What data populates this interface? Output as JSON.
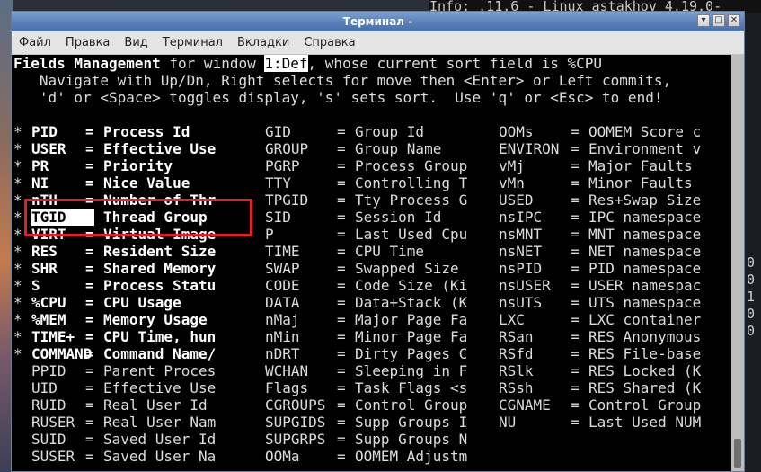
{
  "desktop": {
    "top_right_text": "Info: .11.6 - Linux astakhov 4.19.0-",
    "right_column": [
      "0",
      "0",
      "1",
      "0",
      "0"
    ]
  },
  "window": {
    "title": "Терминал -",
    "buttons": [
      "▾",
      "□",
      "✕"
    ],
    "menu": [
      "Файл",
      "Правка",
      "Вид",
      "Терминал",
      "Вкладки",
      "Справка"
    ]
  },
  "terminal": {
    "header": {
      "line1_bold": "Fields Management",
      "line1_mid": " for window ",
      "line1_win": "1:Def",
      "line1_end": ", whose current sort field is %CPU",
      "line2": "   Navigate with Up/Dn, Right selects for move then <Enter> or Left commits,",
      "line3": "   'd' or <Space> toggles display, 's' sets sort.  Use 'q' or <Esc> to end!"
    },
    "columns": [
      [
        {
          "mark": "*",
          "name": "PID",
          "desc": "Process Id",
          "on": true
        },
        {
          "mark": "*",
          "name": "USER",
          "desc": "Effective Use",
          "on": true
        },
        {
          "mark": "*",
          "name": "PR",
          "desc": "Priority",
          "on": true
        },
        {
          "mark": "*",
          "name": "NI",
          "desc": "Nice Value",
          "on": true
        },
        {
          "mark": "*",
          "name": "nTH",
          "desc": "Number of Thr",
          "on": true
        },
        {
          "mark": "*",
          "name": "TGID",
          "desc": "Thread Group",
          "on": true,
          "selected": true
        },
        {
          "mark": "*",
          "name": "VIRT",
          "desc": "Virtual Image",
          "on": true
        },
        {
          "mark": "*",
          "name": "RES",
          "desc": "Resident Size",
          "on": true
        },
        {
          "mark": "*",
          "name": "SHR",
          "desc": "Shared Memory",
          "on": true
        },
        {
          "mark": "*",
          "name": "S",
          "desc": "Process Statu",
          "on": true
        },
        {
          "mark": "*",
          "name": "%CPU",
          "desc": "CPU Usage",
          "on": true
        },
        {
          "mark": "*",
          "name": "%MEM",
          "desc": "Memory Usage",
          "on": true
        },
        {
          "mark": "*",
          "name": "TIME+",
          "desc": "CPU Time, hun",
          "on": true
        },
        {
          "mark": "*",
          "name": "COMMAND",
          "desc": "Command Name/",
          "on": true
        },
        {
          "mark": "",
          "name": "PPID",
          "desc": "Parent Proces",
          "on": false
        },
        {
          "mark": "",
          "name": "UID",
          "desc": "Effective Use",
          "on": false
        },
        {
          "mark": "",
          "name": "RUID",
          "desc": "Real User Id",
          "on": false
        },
        {
          "mark": "",
          "name": "RUSER",
          "desc": "Real User Nam",
          "on": false
        },
        {
          "mark": "",
          "name": "SUID",
          "desc": "Saved User Id",
          "on": false
        },
        {
          "mark": "",
          "name": "SUSER",
          "desc": "Saved User Na",
          "on": false
        }
      ],
      [
        {
          "name": "GID",
          "desc": "Group Id"
        },
        {
          "name": "GROUP",
          "desc": "Group Name"
        },
        {
          "name": "PGRP",
          "desc": "Process Group"
        },
        {
          "name": "TTY",
          "desc": "Controlling T"
        },
        {
          "name": "TPGID",
          "desc": "Tty Process G"
        },
        {
          "name": "SID",
          "desc": "Session Id"
        },
        {
          "name": "P",
          "desc": "Last Used Cpu"
        },
        {
          "name": "TIME",
          "desc": "CPU Time"
        },
        {
          "name": "SWAP",
          "desc": "Swapped Size"
        },
        {
          "name": "CODE",
          "desc": "Code Size (Ki"
        },
        {
          "name": "DATA",
          "desc": "Data+Stack (K"
        },
        {
          "name": "nMaj",
          "desc": "Major Page Fa"
        },
        {
          "name": "nMin",
          "desc": "Minor Page Fa"
        },
        {
          "name": "nDRT",
          "desc": "Dirty Pages C"
        },
        {
          "name": "WCHAN",
          "desc": "Sleeping in F"
        },
        {
          "name": "Flags",
          "desc": "Task Flags <s"
        },
        {
          "name": "CGROUPS",
          "desc": "Control Group"
        },
        {
          "name": "SUPGIDS",
          "desc": "Supp Groups I"
        },
        {
          "name": "SUPGRPS",
          "desc": "Supp Groups N"
        },
        {
          "name": "OOMa",
          "desc": "OOMEM Adjustm"
        }
      ],
      [
        {
          "name": "OOMs",
          "desc": "OOMEM Score c"
        },
        {
          "name": "ENVIRON",
          "desc": "Environment v"
        },
        {
          "name": "vMj",
          "desc": "Major Faults"
        },
        {
          "name": "vMn",
          "desc": "Minor Faults"
        },
        {
          "name": "USED",
          "desc": "Res+Swap Size"
        },
        {
          "name": "nsIPC",
          "desc": "IPC namespace"
        },
        {
          "name": "nsMNT",
          "desc": "MNT namespace"
        },
        {
          "name": "nsNET",
          "desc": "NET namespace"
        },
        {
          "name": "nsPID",
          "desc": "PID namespace"
        },
        {
          "name": "nsUSER",
          "desc": "USER namespac"
        },
        {
          "name": "nsUTS",
          "desc": "UTS namespace"
        },
        {
          "name": "LXC",
          "desc": "LXC container"
        },
        {
          "name": "RSan",
          "desc": "RES Anonymous"
        },
        {
          "name": "RSfd",
          "desc": "RES File-base"
        },
        {
          "name": "RSlk",
          "desc": "RES Locked (K"
        },
        {
          "name": "RSsh",
          "desc": "RES Shared (K"
        },
        {
          "name": "CGNAME",
          "desc": "Control Group"
        },
        {
          "name": "NU",
          "desc": "Last Used NUM"
        }
      ]
    ],
    "highlight_color": "#e0202a"
  }
}
